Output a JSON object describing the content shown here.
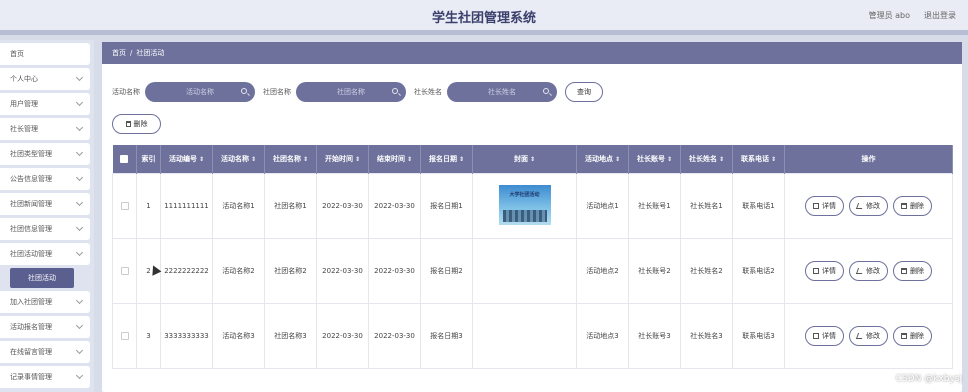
{
  "header": {
    "title": "学生社团管理系统",
    "user_label": "管理员 abo",
    "logout_label": "退出登录"
  },
  "sidebar": {
    "items": [
      {
        "label": "首页",
        "chevron": false
      },
      {
        "label": "个人中心",
        "chevron": true
      },
      {
        "label": "用户管理",
        "chevron": true
      },
      {
        "label": "社长管理",
        "chevron": true
      },
      {
        "label": "社团类型管理",
        "chevron": true
      },
      {
        "label": "公告信息管理",
        "chevron": true
      },
      {
        "label": "社团新闻管理",
        "chevron": true
      },
      {
        "label": "社团信息管理",
        "chevron": true
      },
      {
        "label": "社团活动管理",
        "chevron": true
      }
    ],
    "active_sub": "社团活动",
    "items_after": [
      {
        "label": "加入社团管理",
        "chevron": true
      },
      {
        "label": "活动报名管理",
        "chevron": true
      },
      {
        "label": "在线留言管理",
        "chevron": true
      },
      {
        "label": "记录事情管理",
        "chevron": true
      }
    ]
  },
  "breadcrumb": {
    "home": "首页",
    "separator": "/",
    "current": "社团活动"
  },
  "search": {
    "fields": [
      {
        "label": "活动名称",
        "placeholder": "活动名称"
      },
      {
        "label": "社团名称",
        "placeholder": "社团名称"
      },
      {
        "label": "社长姓名",
        "placeholder": "社长姓名"
      }
    ],
    "query_label": "查询"
  },
  "toolbar": {
    "delete_label": "删除"
  },
  "table": {
    "columns": [
      "索引",
      "活动编号",
      "活动名称",
      "社团名称",
      "开始时间",
      "结束时间",
      "报名日期",
      "封面",
      "活动地点",
      "社长账号",
      "社长姓名",
      "联系电话",
      "操作"
    ],
    "rows": [
      {
        "index": "1",
        "code": "1111111111",
        "activity": "活动名称1",
        "club": "社团名称1",
        "start": "2022-03-30",
        "end": "2022-03-30",
        "signup": "报名日期1",
        "has_cover": true,
        "place": "活动地点1",
        "account": "社长账号1",
        "leader": "社长姓名1",
        "phone": "联系电话1"
      },
      {
        "index": "2",
        "code": "2222222222",
        "activity": "活动名称2",
        "club": "社团名称2",
        "start": "2022-03-30",
        "end": "2022-03-30",
        "signup": "报名日期2",
        "has_cover": false,
        "place": "活动地点2",
        "account": "社长账号2",
        "leader": "社长姓名2",
        "phone": "联系电话2"
      },
      {
        "index": "3",
        "code": "3333333333",
        "activity": "活动名称3",
        "club": "社团名称3",
        "start": "2022-03-30",
        "end": "2022-03-30",
        "signup": "报名日期3",
        "has_cover": false,
        "place": "活动地点3",
        "account": "社长账号3",
        "leader": "社长姓名3",
        "phone": "联系电话3"
      }
    ],
    "actions": {
      "detail": "详情",
      "edit": "修改",
      "delete": "删除"
    },
    "cover_caption": "大学社团活动"
  },
  "watermark": "CSDN @kxbysj"
}
